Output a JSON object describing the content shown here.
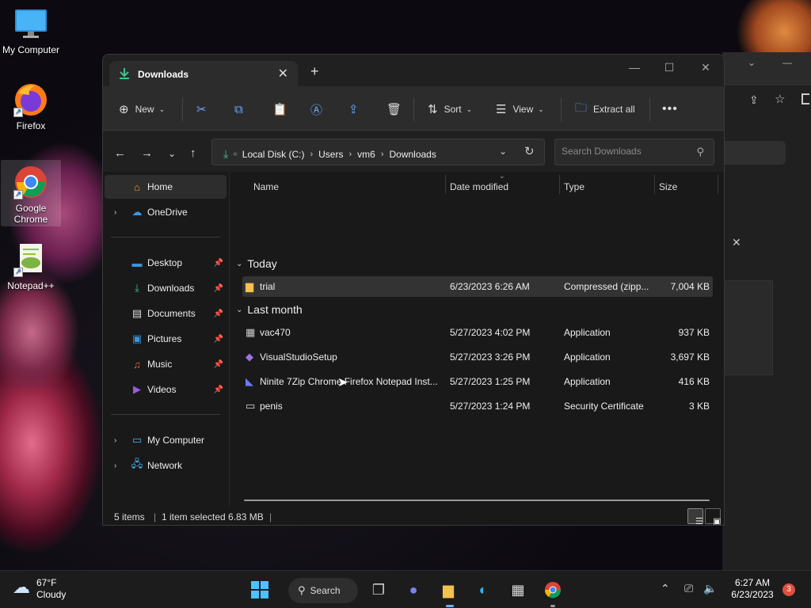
{
  "desktop": {
    "icons": [
      {
        "label": "My Computer"
      },
      {
        "label": "Firefox"
      },
      {
        "label": "Google Chrome"
      },
      {
        "label": "Notepad++"
      }
    ]
  },
  "explorer": {
    "tab_title": "Downloads",
    "commands": {
      "new_label": "New",
      "sort_label": "Sort",
      "view_label": "View",
      "extract_label": "Extract all"
    },
    "breadcrumbs": [
      "Local Disk (C:)",
      "Users",
      "vm6",
      "Downloads"
    ],
    "search_placeholder": "Search Downloads",
    "sidebar": {
      "home": "Home",
      "onedrive": "OneDrive",
      "pinned": [
        "Desktop",
        "Downloads",
        "Documents",
        "Pictures",
        "Music",
        "Videos"
      ],
      "my_computer": "My Computer",
      "network": "Network"
    },
    "columns": {
      "name": "Name",
      "date": "Date modified",
      "type": "Type",
      "size": "Size"
    },
    "groups": [
      {
        "label": "Today",
        "files": [
          {
            "name": "trial",
            "date": "6/23/2023 6:26 AM",
            "type": "Compressed (zipp...",
            "size": "7,004 KB",
            "icon": "zip-folder-icon",
            "selected": true
          }
        ]
      },
      {
        "label": "Last month",
        "files": [
          {
            "name": "vac470",
            "date": "5/27/2023 4:02 PM",
            "type": "Application",
            "size": "937 KB",
            "icon": "application-icon"
          },
          {
            "name": "VisualStudioSetup",
            "date": "5/27/2023 3:26 PM",
            "type": "Application",
            "size": "3,697 KB",
            "icon": "visual-studio-icon"
          },
          {
            "name": "Ninite 7Zip Chrome Firefox Notepad Inst...",
            "date": "5/27/2023 1:25 PM",
            "type": "Application",
            "size": "416 KB",
            "icon": "ninite-icon"
          },
          {
            "name": "penis",
            "date": "5/27/2023 1:24 PM",
            "type": "Security Certificate",
            "size": "3 KB",
            "icon": "certificate-icon"
          }
        ]
      }
    ],
    "status": {
      "items": "5 items",
      "selected": "1 item selected  6.83 MB"
    }
  },
  "taskbar": {
    "weather": {
      "temp": "67°F",
      "condition": "Cloudy"
    },
    "search_label": "Search",
    "time": "6:27 AM",
    "date": "6/23/2023",
    "notification_count": "3"
  },
  "colors": {
    "accent": "#4aa0ff",
    "folder": "#f2c14e",
    "taskbar": "#1c1c1c",
    "window": "#191919"
  }
}
